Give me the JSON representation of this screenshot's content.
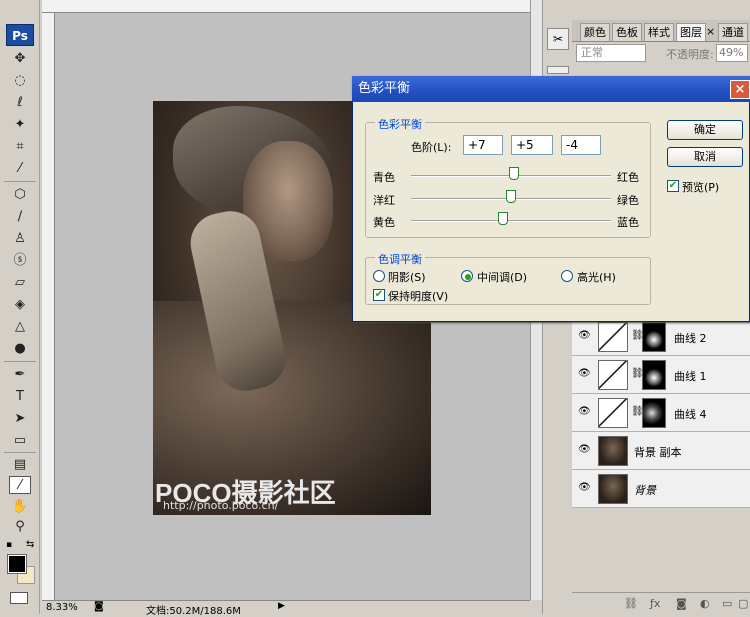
{
  "app": {
    "logo": "Ps"
  },
  "status": {
    "zoom": "8.33%",
    "doc": "文档:50.2M/188.6M"
  },
  "watermark": {
    "brand": "POCO摄影社区",
    "url": "http://photo.poco.cn/"
  },
  "panel": {
    "tabs": [
      "颜色",
      "色板",
      "样式",
      "图层",
      "通道"
    ],
    "tab_close": "×",
    "blend_mode": "正常",
    "opacity_label": "不透明度:",
    "opacity_value": "49%",
    "layers": [
      {
        "name": "曲线 2"
      },
      {
        "name": "曲线 1"
      },
      {
        "name": "曲线 4"
      },
      {
        "name": "背景 副本"
      },
      {
        "name": "背景"
      }
    ]
  },
  "dialog": {
    "title": "色彩平衡",
    "close": "×",
    "balance_group": "色彩平衡",
    "levels_label": "色阶(L):",
    "levels": [
      "+7",
      "+5",
      "-4"
    ],
    "sliders": [
      {
        "left": "青色",
        "right": "红色",
        "value": 7
      },
      {
        "left": "洋红",
        "right": "绿色",
        "value": 5
      },
      {
        "left": "黄色",
        "right": "蓝色",
        "value": -4
      }
    ],
    "tone_group": "色调平衡",
    "tones": [
      {
        "label": "阴影(S)",
        "selected": false
      },
      {
        "label": "中间调(D)",
        "selected": true
      },
      {
        "label": "高光(H)",
        "selected": false
      }
    ],
    "preserve_label": "保持明度(V)",
    "preserve_checked": true,
    "ok": "确定",
    "cancel": "取消",
    "preview_label": "预览(P)",
    "preview_checked": true
  }
}
